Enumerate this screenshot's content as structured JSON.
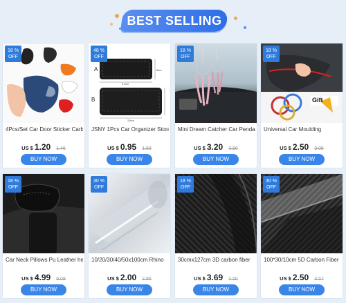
{
  "banner": {
    "title": "BEST SELLING"
  },
  "colors": {
    "accent": "#3a86e8",
    "badge": "#2f7bdc",
    "background": "#e6eef8"
  },
  "products": [
    {
      "discount": "18 %",
      "off": "OFF",
      "title": "4Pcs/Set Car Door Sticker Carbon",
      "currency": "US $",
      "price": "1.20",
      "old_price": "1.46",
      "button": "BUY NOW",
      "image": "door-sticker-image"
    },
    {
      "discount": "48 %",
      "off": "OFF",
      "title": "JSNY 1Pcs Car Organizer Storage",
      "currency": "US $",
      "price": "0.95",
      "old_price": "1.83",
      "button": "BUY NOW",
      "image": "car-organizer-image",
      "diagram": {
        "label_a": "A",
        "label_b": "B",
        "dim_a": "27cm",
        "dim_b": "20cm",
        "dim_h": "8cm"
      }
    },
    {
      "discount": "18 %",
      "off": "OFF",
      "title": "Mini Dream Catcher Car Pendant",
      "currency": "US $",
      "price": "3.20",
      "old_price": "3.90",
      "button": "BUY NOW",
      "image": "dream-catcher-image"
    },
    {
      "discount": "18 %",
      "off": "OFF",
      "title": "Universal Car Moulding",
      "currency": "US $",
      "price": "2.50",
      "old_price": "3.05",
      "button": "BUY NOW",
      "image": "car-moulding-image",
      "gift": "Gift"
    },
    {
      "discount": "18 %",
      "off": "OFF",
      "title": "Car Neck Pillows Pu Leather head",
      "currency": "US $",
      "price": "4.99",
      "old_price": "6.09",
      "button": "BUY NOW",
      "image": "neck-pillow-image"
    },
    {
      "discount": "30 %",
      "off": "OFF",
      "title": "10/20/30/40/50x100cm Rhino",
      "currency": "US $",
      "price": "2.00",
      "old_price": "2.86",
      "button": "BUY NOW",
      "image": "rhino-film-image"
    },
    {
      "discount": "18 %",
      "off": "OFF",
      "title": "30cmx127cm 3D carbon fiber",
      "currency": "US $",
      "price": "3.69",
      "old_price": "4.50",
      "button": "BUY NOW",
      "image": "carbon-fiber-image"
    },
    {
      "discount": "30 %",
      "off": "OFF",
      "title": "100*30/10cm 5D Carbon Fiber",
      "currency": "US $",
      "price": "2.50",
      "old_price": "3.57",
      "button": "BUY NOW",
      "image": "carbon-5d-image"
    }
  ]
}
